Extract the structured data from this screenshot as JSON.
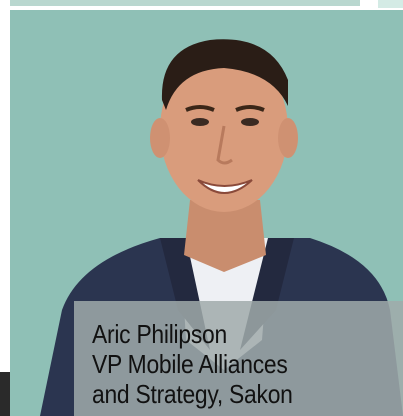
{
  "colors": {
    "photo_background": "#8fc0b6",
    "caption_background": "#a0aaaa",
    "caption_text": "#111111",
    "suit": "#2b3550",
    "shirt": "#eef0f4",
    "skin": "#d99c7c",
    "hair": "#2a1d16"
  },
  "photo": {
    "icon": "person-photo"
  },
  "caption": {
    "name": "Aric Philipson",
    "title_line_1": "VP Mobile Alliances",
    "title_line_2": "and Strategy, Sakon"
  }
}
